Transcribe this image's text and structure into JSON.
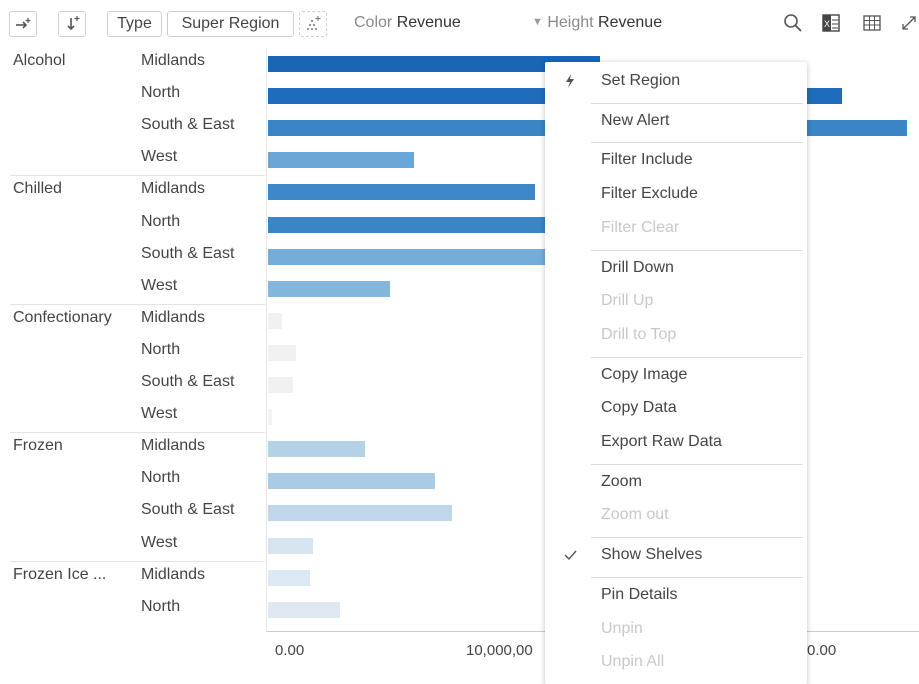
{
  "toolbar": {
    "type_label": "Type",
    "super_region_label": "Super Region",
    "color_key": "Color",
    "color_value": "Revenue",
    "height_key": "Height",
    "height_value": "Revenue",
    "icons": [
      "add-column-icon",
      "add-row-icon",
      "scatter-add-icon",
      "dropdown-caret-icon",
      "search-icon",
      "excel-export-icon",
      "table-icon",
      "expand-icon"
    ]
  },
  "chart_data": {
    "type": "bar",
    "orientation": "horizontal",
    "xlabel": "",
    "ylabel": "",
    "xlim": [
      0,
      23000000
    ],
    "tick_labels": [
      "0.00",
      "10,000,00",
      "0.00"
    ],
    "categories": [
      {
        "name": "Alcohol",
        "regions": [
          {
            "name": "Midlands",
            "value": 11800000,
            "color": "#1a66b5"
          },
          {
            "name": "North",
            "value": 20400000,
            "color": "#1f6cbd"
          },
          {
            "name": "South & East",
            "value": 22700000,
            "color": "#3a85c6"
          },
          {
            "name": "West",
            "value": 5200000,
            "color": "#6aa6d6"
          }
        ]
      },
      {
        "name": "Chilled",
        "regions": [
          {
            "name": "Midlands",
            "value": 9500000,
            "color": "#3d86c7"
          },
          {
            "name": "North",
            "value": 10200000,
            "color": "#3a85c6"
          },
          {
            "name": "South & East",
            "value": 10500000,
            "color": "#76acd8"
          },
          {
            "name": "West",
            "value": 4350000,
            "color": "#84b6dc"
          }
        ]
      },
      {
        "name": "Confectionary",
        "regions": [
          {
            "name": "Midlands",
            "value": 500000,
            "color": "#f1f1f1"
          },
          {
            "name": "North",
            "value": 1000000,
            "color": "#f1f1f1"
          },
          {
            "name": "South & East",
            "value": 900000,
            "color": "#f1f1f1"
          },
          {
            "name": "West",
            "value": 150000,
            "color": "#f3f3f3"
          }
        ]
      },
      {
        "name": "Frozen",
        "regions": [
          {
            "name": "Midlands",
            "value": 3450000,
            "color": "#b4d2e6"
          },
          {
            "name": "North",
            "value": 5950000,
            "color": "#a9cce4"
          },
          {
            "name": "South & East",
            "value": 6550000,
            "color": "#bed7ea"
          },
          {
            "name": "West",
            "value": 1600000,
            "color": "#d6e5f0"
          }
        ]
      },
      {
        "name": "Frozen Ice ...",
        "regions": [
          {
            "name": "Midlands",
            "value": 1500000,
            "color": "#dde9f2"
          },
          {
            "name": "North",
            "value": 2550000,
            "color": "#dde8f0"
          }
        ]
      }
    ]
  },
  "context_menu": {
    "groups": [
      [
        {
          "label": "Set Region",
          "disabled": false,
          "icon": "lightning-icon"
        }
      ],
      [
        {
          "label": "New Alert",
          "disabled": false
        }
      ],
      [
        {
          "label": "Filter Include",
          "disabled": false
        },
        {
          "label": "Filter Exclude",
          "disabled": false
        },
        {
          "label": "Filter Clear",
          "disabled": true
        }
      ],
      [
        {
          "label": "Drill Down",
          "disabled": false
        },
        {
          "label": "Drill Up",
          "disabled": true
        },
        {
          "label": "Drill to Top",
          "disabled": true
        }
      ],
      [
        {
          "label": "Copy Image",
          "disabled": false
        },
        {
          "label": "Copy Data",
          "disabled": false
        },
        {
          "label": "Export Raw Data",
          "disabled": false
        }
      ],
      [
        {
          "label": "Zoom",
          "disabled": false
        },
        {
          "label": "Zoom out",
          "disabled": true
        }
      ],
      [
        {
          "label": "Show Shelves",
          "disabled": false,
          "icon": "checkmark-icon"
        }
      ],
      [
        {
          "label": "Pin Details",
          "disabled": false
        },
        {
          "label": "Unpin",
          "disabled": true
        },
        {
          "label": "Unpin All",
          "disabled": true
        }
      ]
    ]
  }
}
